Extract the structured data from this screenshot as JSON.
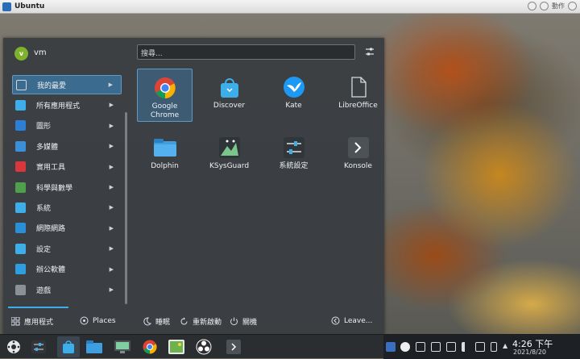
{
  "window": {
    "title": "Ubuntu",
    "action_label": "動作"
  },
  "user": {
    "initial": "v",
    "name": "vm"
  },
  "search": {
    "placeholder": "搜尋..."
  },
  "sidebar": {
    "items": [
      {
        "label": "我的最愛",
        "icon": "star-icon",
        "color": "#d0d6db"
      },
      {
        "label": "所有應用程式",
        "icon": "grid-icon",
        "color": "#3daee9"
      },
      {
        "label": "圖形",
        "icon": "graphics-icon",
        "color": "#2d7fd3"
      },
      {
        "label": "多媒體",
        "icon": "multimedia-icon",
        "color": "#3b8fd9"
      },
      {
        "label": "實用工具",
        "icon": "toolbox-icon",
        "color": "#d8383b"
      },
      {
        "label": "科學與數學",
        "icon": "science-icon",
        "color": "#4fa04a"
      },
      {
        "label": "系統",
        "icon": "system-icon",
        "color": "#3daee9"
      },
      {
        "label": "網際網路",
        "icon": "globe-icon",
        "color": "#2b8fd8"
      },
      {
        "label": "設定",
        "icon": "settings-icon",
        "color": "#3daee9"
      },
      {
        "label": "辦公軟體",
        "icon": "office-icon",
        "color": "#2d9fe0"
      },
      {
        "label": "遊戲",
        "icon": "games-icon",
        "color": "#8a9096"
      }
    ]
  },
  "apps": [
    {
      "label": "Google\nChrome",
      "icon": "chrome-icon"
    },
    {
      "label": "Discover",
      "icon": "discover-icon"
    },
    {
      "label": "Kate",
      "icon": "kate-icon"
    },
    {
      "label": "LibreOffice",
      "icon": "libreoffice-icon"
    },
    {
      "label": "Dolphin",
      "icon": "dolphin-icon"
    },
    {
      "label": "KSysGuard",
      "icon": "ksysguard-icon"
    },
    {
      "label": "系統設定",
      "icon": "system-settings-icon"
    },
    {
      "label": "Konsole",
      "icon": "konsole-icon"
    }
  ],
  "footer": {
    "apps": "應用程式",
    "places": "Places",
    "sleep": "睡眠",
    "restart": "重新啟動",
    "shutdown": "關機",
    "leave": "Leave..."
  },
  "clock": {
    "time": "4:26 下午",
    "date": "2021/8/20"
  }
}
